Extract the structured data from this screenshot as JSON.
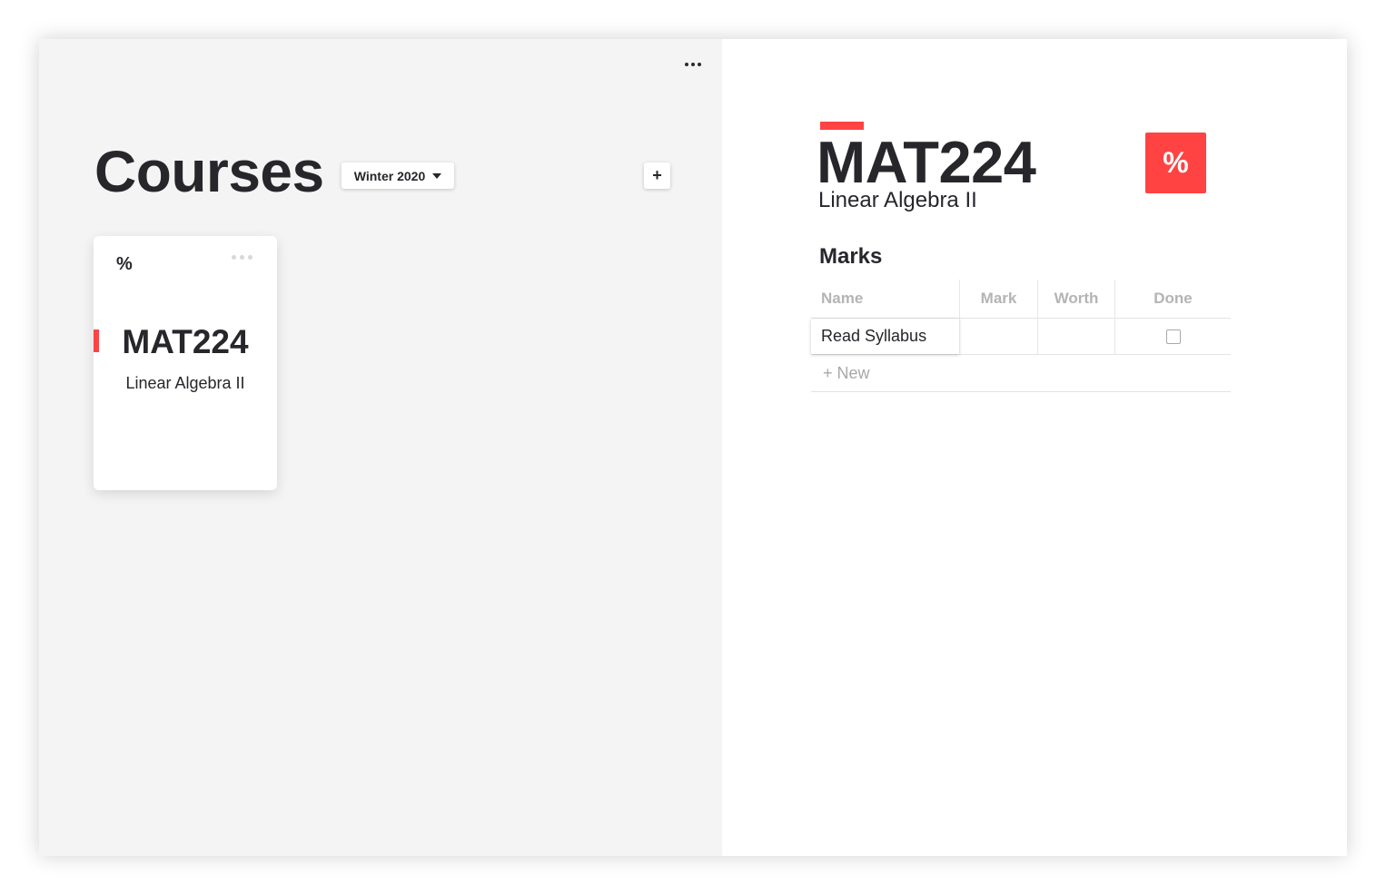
{
  "window": {
    "menu_icon": "more-horizontal-icon"
  },
  "courses_panel": {
    "title": "Courses",
    "term_selector": {
      "value": "Winter 2020",
      "icon": "caret-down-icon"
    },
    "add_button_label": "+",
    "cards": [
      {
        "icon": "%",
        "menu_icon": "more-horizontal-icon",
        "code": "MAT224",
        "name": "Linear Algebra II",
        "accent_color": "#ff4343"
      }
    ]
  },
  "detail_panel": {
    "code": "MAT224",
    "name": "Linear Algebra II",
    "accent_color": "#ff4343",
    "grade_button_label": "%",
    "marks_section_title": "Marks",
    "marks_table": {
      "columns": [
        "Name",
        "Mark",
        "Worth",
        "Done"
      ],
      "rows": [
        {
          "name": "Read Syllabus",
          "mark": "",
          "worth": "",
          "done": false
        }
      ],
      "new_row_label": "+ New"
    }
  },
  "colors": {
    "accent": "#ff4343",
    "left_background": "#f4f4f4",
    "text": "#26262b",
    "muted": "#b4b4b4"
  }
}
